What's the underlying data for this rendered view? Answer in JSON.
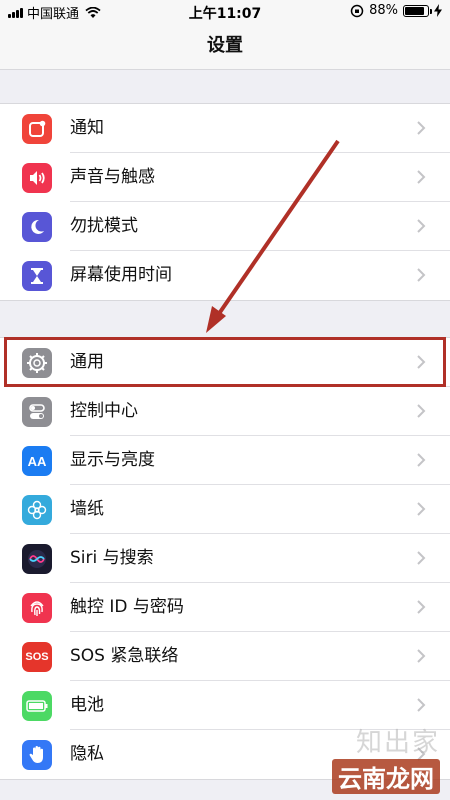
{
  "status_bar": {
    "carrier": "中国联通",
    "time": "上午11:07",
    "battery": "88%",
    "battery_level": 0.88
  },
  "nav": {
    "title": "设置"
  },
  "groups": [
    {
      "items": [
        {
          "label": "通知",
          "icon": "notifications-icon",
          "color": "#f0443a"
        },
        {
          "label": "声音与触感",
          "icon": "sounds-icon",
          "color": "#f0344f"
        },
        {
          "label": "勿扰模式",
          "icon": "moon-icon",
          "color": "#5856d6"
        },
        {
          "label": "屏幕使用时间",
          "icon": "hourglass-icon",
          "color": "#5856d6"
        }
      ]
    },
    {
      "items": [
        {
          "label": "通用",
          "icon": "gear-icon",
          "color": "#8e8e93"
        },
        {
          "label": "控制中心",
          "icon": "toggles-icon",
          "color": "#8e8e93"
        },
        {
          "label": "显示与亮度",
          "icon": "text-size-icon",
          "color": "#1b7cf2"
        },
        {
          "label": "墙纸",
          "icon": "flower-icon",
          "color": "#34aadc"
        },
        {
          "label": "Siri 与搜索",
          "icon": "siri-icon",
          "color": "#1a1a2e"
        },
        {
          "label": "触控 ID 与密码",
          "icon": "fingerprint-icon",
          "color": "#f0344f"
        },
        {
          "label": "SOS 紧急联络",
          "icon": "sos-icon",
          "color": "#e5352b"
        },
        {
          "label": "电池",
          "icon": "battery-icon",
          "color": "#4cd964"
        },
        {
          "label": "隐私",
          "icon": "hand-icon",
          "color": "#3478f6"
        }
      ]
    }
  ],
  "sos_text": "SOS",
  "display_icon_text": "AA",
  "watermark": {
    "line1": "知出家",
    "line2": "云南龙网"
  }
}
